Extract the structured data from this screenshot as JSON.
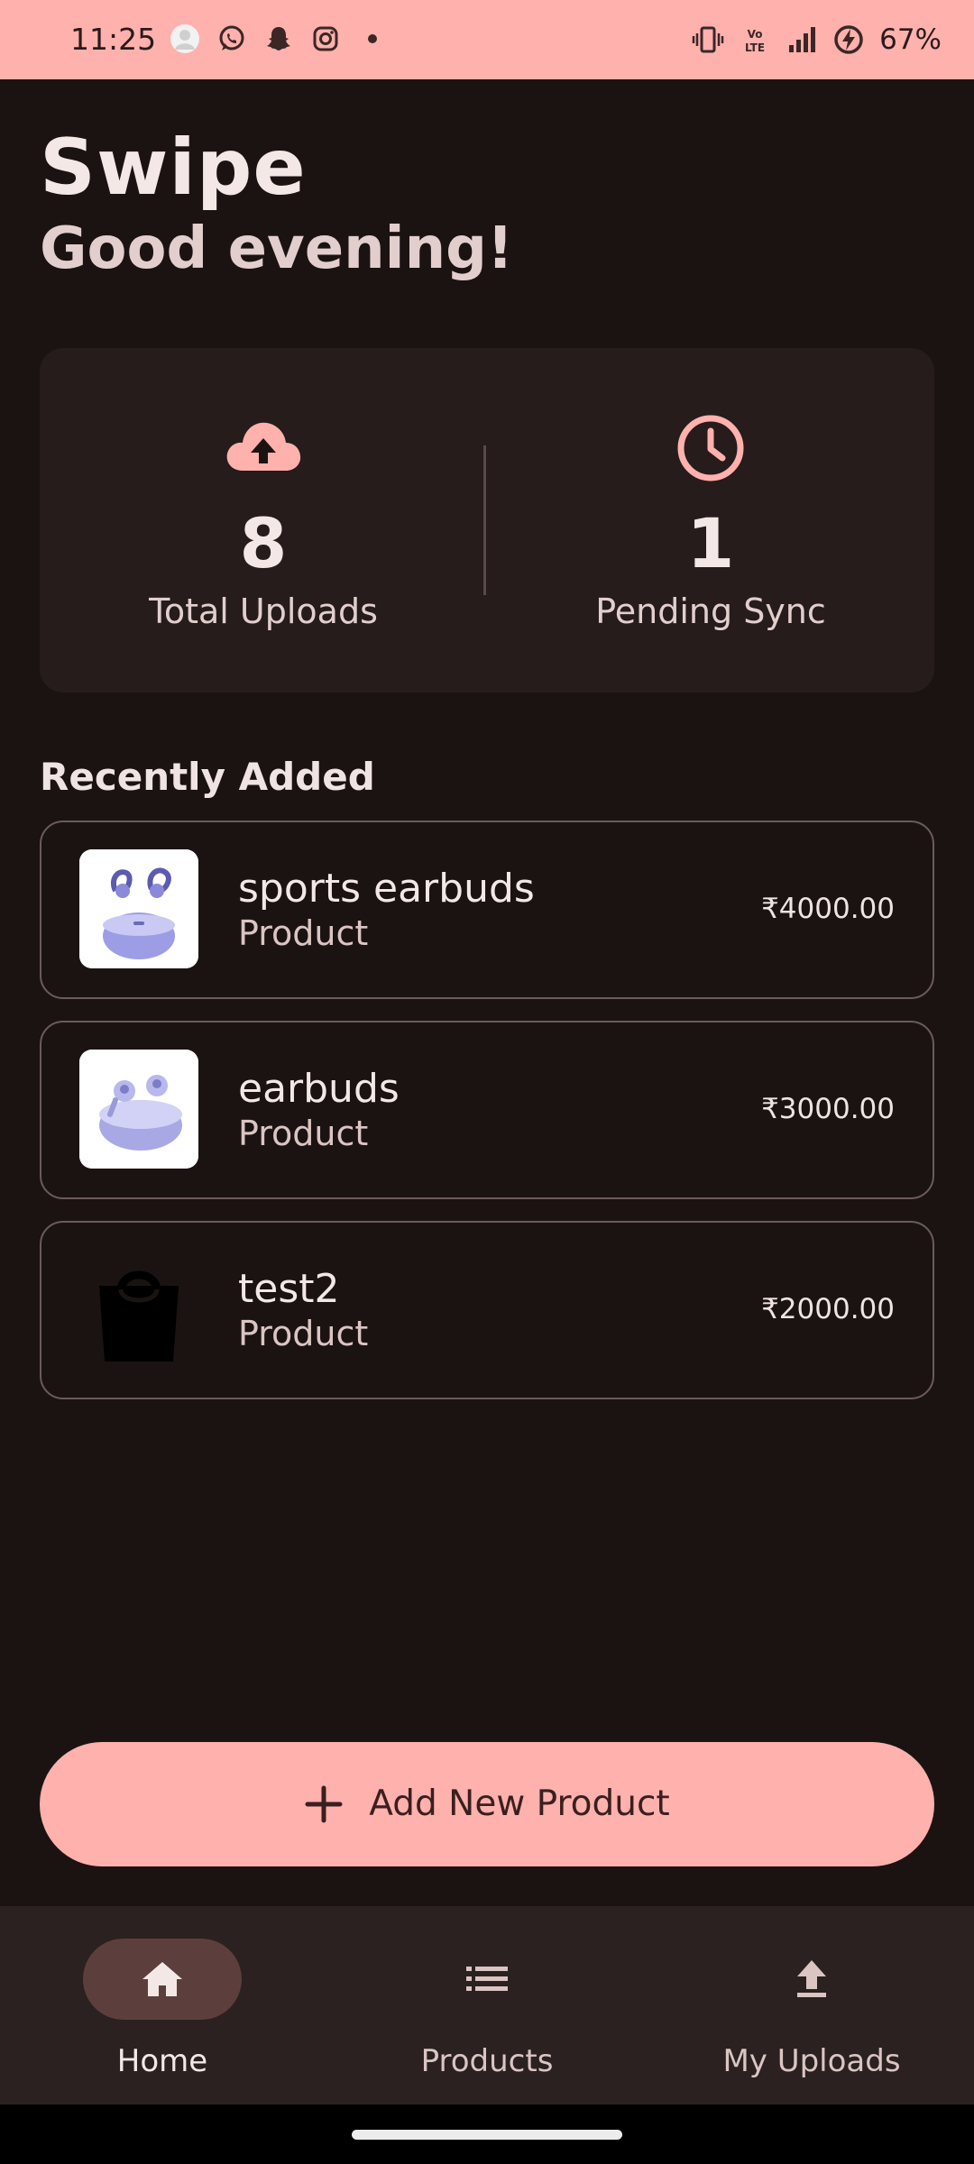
{
  "status_bar": {
    "time": "11:25",
    "battery": "67%",
    "left_icons": [
      "avatar-icon",
      "whatsapp-icon",
      "snapchat-icon",
      "instagram-icon",
      "dot-icon"
    ],
    "right_icons": [
      "vibrate-icon",
      "volte-icon",
      "signal-icon",
      "battery-charging-icon"
    ]
  },
  "header": {
    "app_title": "Swipe",
    "greeting": "Good evening!"
  },
  "stats": {
    "total_uploads": {
      "value": "8",
      "label": "Total Uploads",
      "icon": "cloud-upload-icon"
    },
    "pending_sync": {
      "value": "1",
      "label": "Pending Sync",
      "icon": "clock-icon"
    }
  },
  "recently_added": {
    "title": "Recently Added",
    "items": [
      {
        "name": "sports earbuds",
        "type": "Product",
        "price": "₹4000.00",
        "image": "sports-earbuds-image"
      },
      {
        "name": "earbuds",
        "type": "Product",
        "price": "₹3000.00",
        "image": "earbuds-image"
      },
      {
        "name": "test2",
        "type": "Product",
        "price": "₹2000.00",
        "image": "shopping-bag-image"
      }
    ]
  },
  "add_button": {
    "label": "Add New Product",
    "icon": "plus-icon"
  },
  "bottom_nav": {
    "items": [
      {
        "label": "Home",
        "icon": "home-icon",
        "active": true
      },
      {
        "label": "Products",
        "icon": "list-icon",
        "active": false
      },
      {
        "label": "My Uploads",
        "icon": "upload-icon",
        "active": false
      }
    ]
  },
  "colors": {
    "background": "#1b1312",
    "card": "#251c1b",
    "accent": "#ffb1ad",
    "nav_background": "#2a2120",
    "active_pill": "#5c3f3c"
  }
}
